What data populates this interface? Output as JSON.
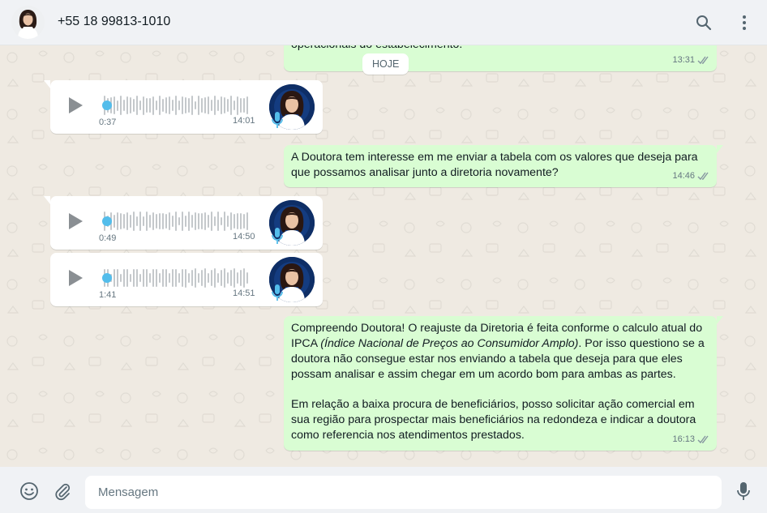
{
  "header": {
    "contact_name": "+55 18 99813-1010",
    "search_icon": "search-icon",
    "menu_icon": "kebab-menu-icon"
  },
  "chat": {
    "date_chip": "HOJE",
    "messages": [
      {
        "type": "text",
        "direction": "outgoing",
        "text": "operacionais do estabelecimento.",
        "time": "13:31",
        "status": "read"
      },
      {
        "type": "audio",
        "direction": "incoming",
        "duration": "0:37",
        "time": "14:01",
        "progress": 0
      },
      {
        "type": "text",
        "direction": "outgoing",
        "text": "A Doutora tem interesse em me enviar a tabela com os valores que deseja para que possamos analisar junto a diretoria novamente?",
        "time": "14:46",
        "status": "read"
      },
      {
        "type": "audio",
        "direction": "incoming",
        "duration": "0:49",
        "time": "14:50",
        "progress": 0
      },
      {
        "type": "audio",
        "direction": "incoming",
        "duration": "1:41",
        "time": "14:51",
        "progress": 0
      },
      {
        "type": "text",
        "direction": "outgoing",
        "p1_before": "Compreendo Doutora! O reajuste da Diretoria é feita conforme o calculo atual do IPCA ",
        "p1_italic": "(Índice Nacional de Preços ao Consumidor Amplo)",
        "p1_after": ". Por isso questiono se a doutora não consegue estar nos enviando a tabela que deseja para que eles possam analisar e assim chegar em um acordo bom para ambas as partes.",
        "p2": "Em relação a baixa procura de beneficiários, posso solicitar ação comercial em sua região para prospectar mais beneficiários na redondeza e indicar a doutora como referencia nos atendimentos prestados.",
        "time": "16:13",
        "status": "read"
      }
    ]
  },
  "footer": {
    "placeholder": "Mensagem",
    "emoji_icon": "emoji-icon",
    "attach_icon": "paperclip-icon",
    "mic_icon": "microphone-icon"
  },
  "colors": {
    "outgoing_bubble": "#d9fdd3",
    "incoming_bubble": "#ffffff",
    "audio_accent": "#53bdeb",
    "read_ticks": "#8696a0",
    "background": "#efeae2"
  }
}
